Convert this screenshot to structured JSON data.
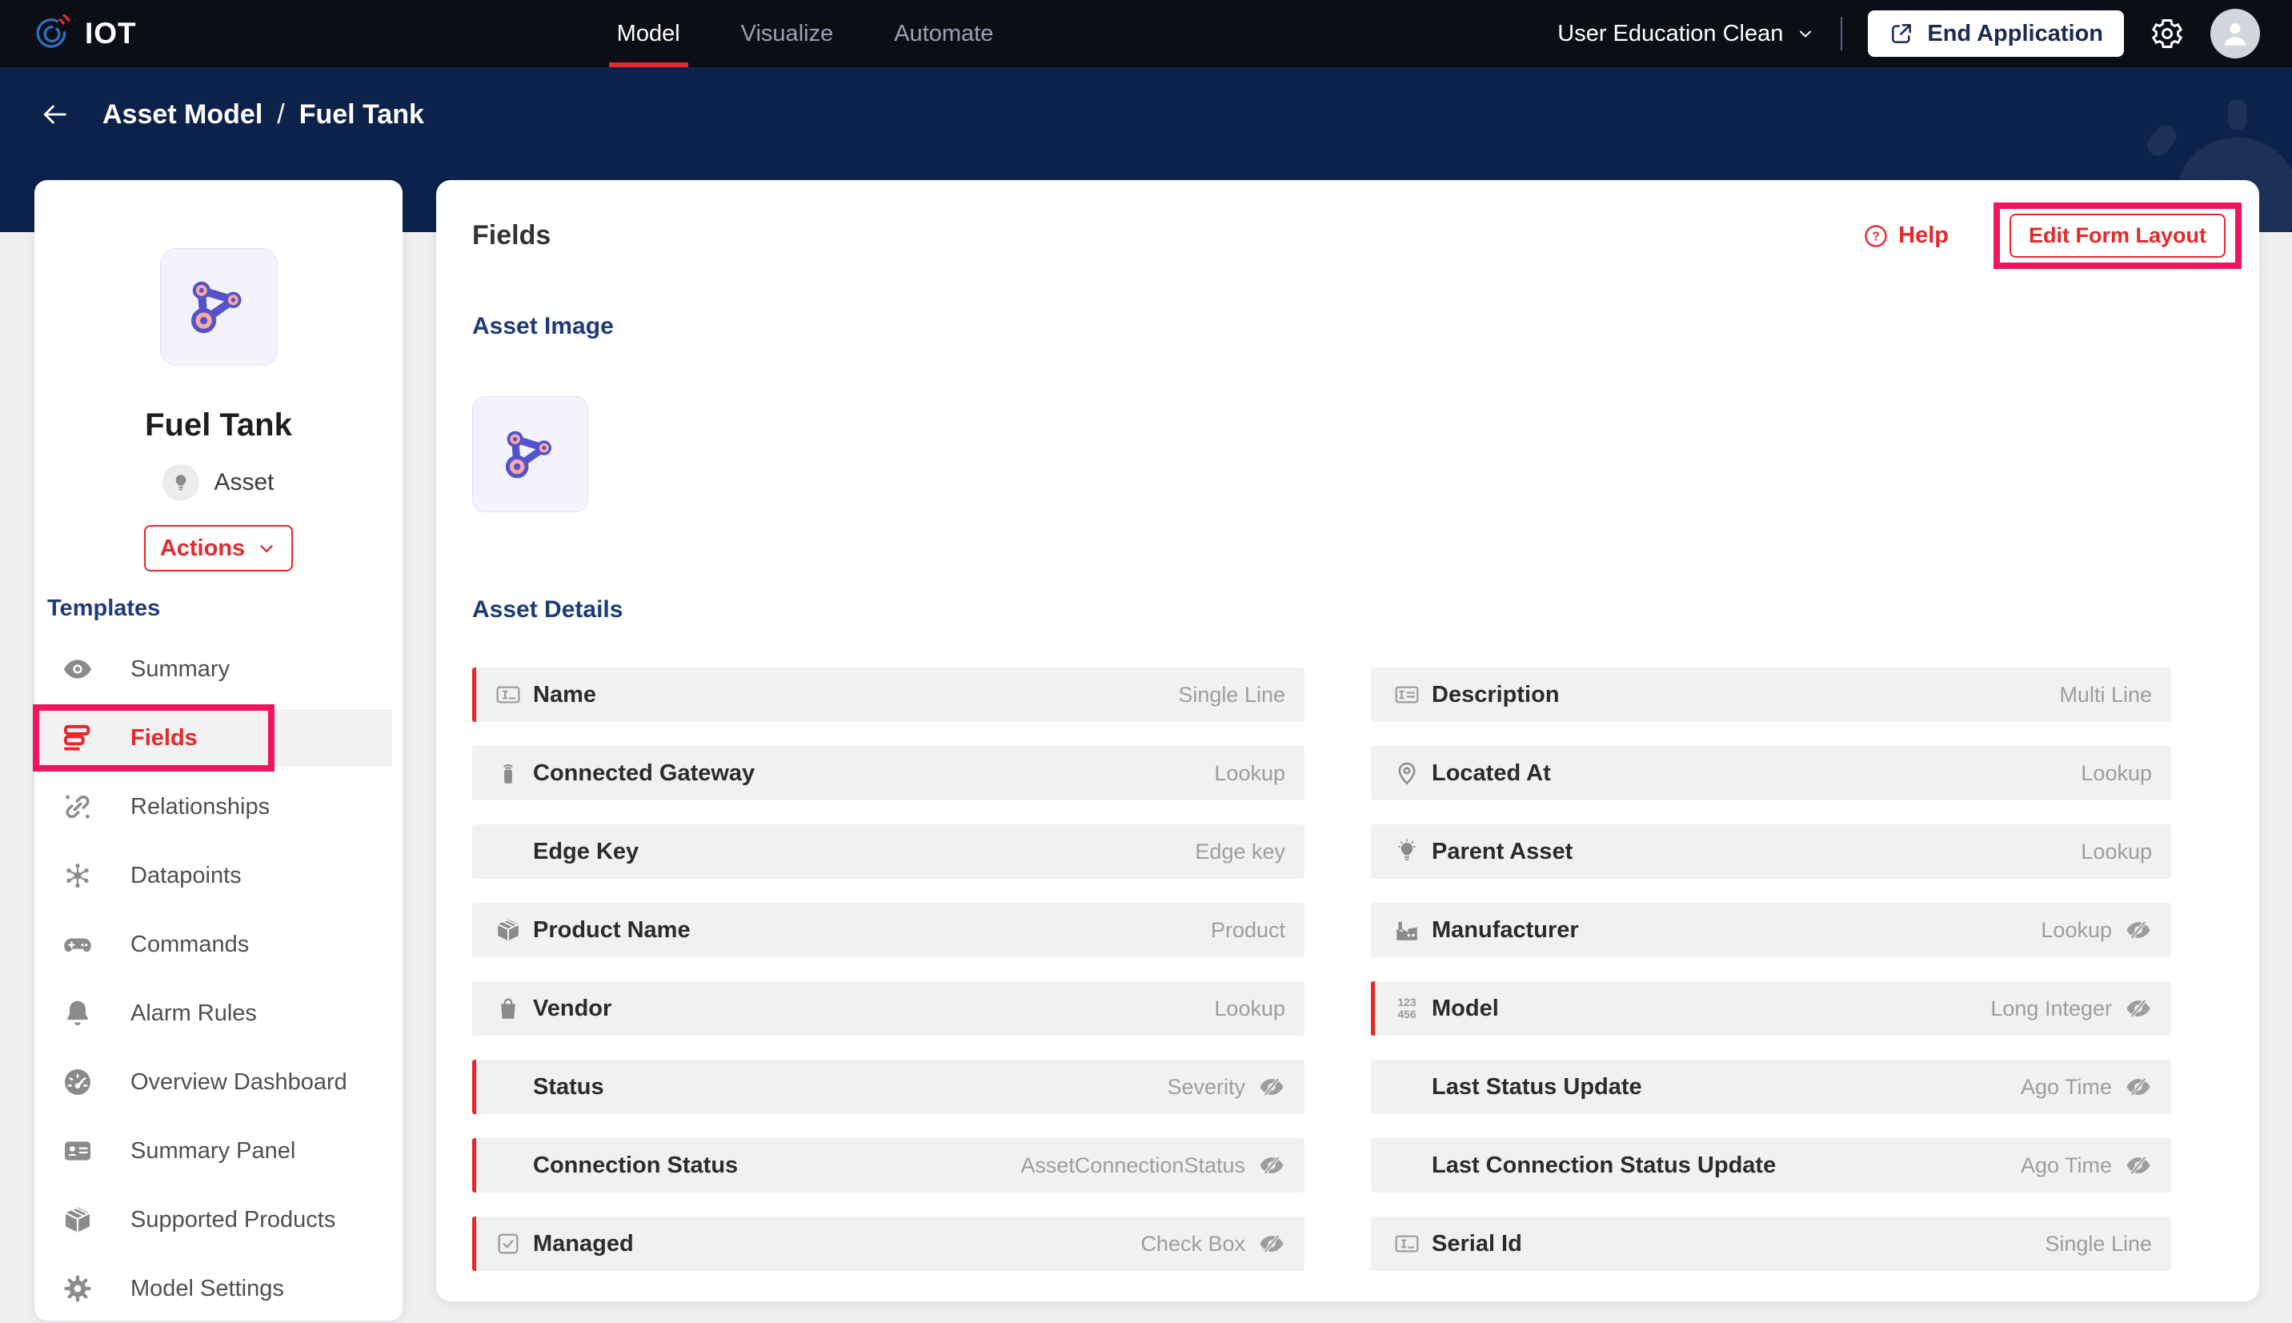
{
  "navbar": {
    "logo_text": "IOT",
    "tabs": [
      {
        "label": "Model",
        "active": true
      },
      {
        "label": "Visualize",
        "active": false
      },
      {
        "label": "Automate",
        "active": false
      }
    ],
    "app_name": "User Education Clean",
    "end_application_label": "End Application"
  },
  "breadcrumb": {
    "section": "Asset Model",
    "separator": "/",
    "page": "Fuel Tank"
  },
  "sidebar": {
    "asset_name": "Fuel Tank",
    "asset_type_label": "Asset",
    "actions_label": "Actions",
    "templates_heading": "Templates",
    "items": [
      {
        "label": "Summary",
        "icon": "eye-icon",
        "active": false,
        "annotated": false
      },
      {
        "label": "Fields",
        "icon": "fields-icon",
        "active": true,
        "annotated": true
      },
      {
        "label": "Relationships",
        "icon": "link-icon",
        "active": false,
        "annotated": false
      },
      {
        "label": "Datapoints",
        "icon": "datapoints-icon",
        "active": false,
        "annotated": false
      },
      {
        "label": "Commands",
        "icon": "gamepad-icon",
        "active": false,
        "annotated": false
      },
      {
        "label": "Alarm Rules",
        "icon": "bell-icon",
        "active": false,
        "annotated": false
      },
      {
        "label": "Overview Dashboard",
        "icon": "gauge-icon",
        "active": false,
        "annotated": false
      },
      {
        "label": "Summary Panel",
        "icon": "idcard-icon",
        "active": false,
        "annotated": false
      },
      {
        "label": "Supported Products",
        "icon": "package-icon",
        "active": false,
        "annotated": false
      },
      {
        "label": "Model Settings",
        "icon": "gear-icon",
        "active": false,
        "annotated": false
      }
    ]
  },
  "main": {
    "title": "Fields",
    "help_label": "Help",
    "edit_form_layout_label": "Edit Form Layout",
    "asset_image_heading": "Asset Image",
    "asset_details_heading": "Asset Details",
    "fields_left": [
      {
        "label": "Name",
        "type": "Single Line",
        "icon": "single-line-icon",
        "required": true,
        "hidden": false
      },
      {
        "label": "Connected Gateway",
        "type": "Lookup",
        "icon": "gateway-icon",
        "required": false,
        "hidden": false
      },
      {
        "label": "Edge Key",
        "type": "Edge key",
        "icon": null,
        "required": false,
        "hidden": false
      },
      {
        "label": "Product Name",
        "type": "Product",
        "icon": "package-icon",
        "required": false,
        "hidden": false
      },
      {
        "label": "Vendor",
        "type": "Lookup",
        "icon": "bag-icon",
        "required": false,
        "hidden": false
      },
      {
        "label": "Status",
        "type": "Severity",
        "icon": null,
        "required": true,
        "hidden": true
      },
      {
        "label": "Connection Status",
        "type": "AssetConnectionStatus",
        "icon": null,
        "required": true,
        "hidden": true
      },
      {
        "label": "Managed",
        "type": "Check Box",
        "icon": "checkbox-icon",
        "required": true,
        "hidden": true
      }
    ],
    "fields_right": [
      {
        "label": "Description",
        "type": "Multi Line",
        "icon": "multi-line-icon",
        "required": false,
        "hidden": false
      },
      {
        "label": "Located At",
        "type": "Lookup",
        "icon": "location-icon",
        "required": false,
        "hidden": false
      },
      {
        "label": "Parent Asset",
        "type": "Lookup",
        "icon": "bulb-icon",
        "required": false,
        "hidden": false
      },
      {
        "label": "Manufacturer",
        "type": "Lookup",
        "icon": "factory-icon",
        "required": false,
        "hidden": true
      },
      {
        "label": "Model",
        "type": "Long Integer",
        "icon": "numbers-icon",
        "required": true,
        "hidden": true
      },
      {
        "label": "Last Status Update",
        "type": "Ago Time",
        "icon": null,
        "required": false,
        "hidden": true
      },
      {
        "label": "Last Connection Status Update",
        "type": "Ago Time",
        "icon": null,
        "required": false,
        "hidden": true
      },
      {
        "label": "Serial Id",
        "type": "Single Line",
        "icon": "single-line-icon",
        "required": false,
        "hidden": false
      }
    ]
  },
  "colors": {
    "accent_red": "#e5282c",
    "annotation_pink": "#f0155f",
    "navy_heading": "#1e3a78",
    "navbar_bg": "#0b0e15",
    "band_bg": "#0d224a",
    "row_bg": "#f1f1f1"
  }
}
